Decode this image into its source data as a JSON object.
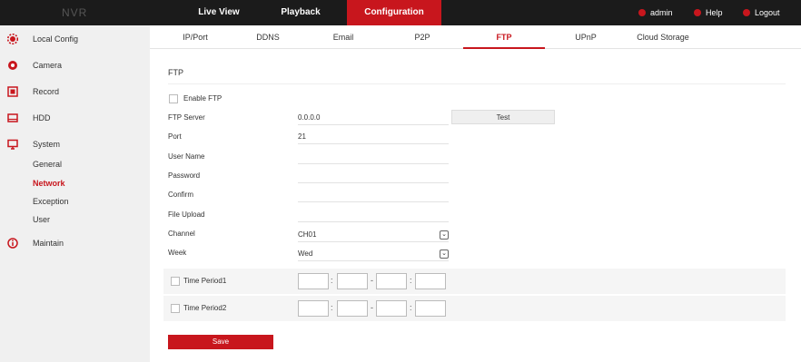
{
  "header": {
    "logo": "NVR",
    "nav": [
      {
        "label": "Live View"
      },
      {
        "label": "Playback"
      },
      {
        "label": "Configuration"
      }
    ],
    "user": "admin",
    "help": "Help",
    "logout": "Logout"
  },
  "sidebar": {
    "items": [
      {
        "label": "Local Config"
      },
      {
        "label": "Camera"
      },
      {
        "label": "Record"
      },
      {
        "label": "HDD"
      },
      {
        "label": "System"
      },
      {
        "label": "Maintain"
      }
    ],
    "sub": [
      {
        "label": "General"
      },
      {
        "label": "Network"
      },
      {
        "label": "Exception"
      },
      {
        "label": "User"
      }
    ]
  },
  "tabs": [
    {
      "label": "IP/Port"
    },
    {
      "label": "DDNS"
    },
    {
      "label": "Email"
    },
    {
      "label": "P2P"
    },
    {
      "label": "FTP"
    },
    {
      "label": "UPnP"
    },
    {
      "label": "Cloud Storage"
    }
  ],
  "form": {
    "section_title": "FTP",
    "enable_label": "Enable FTP",
    "server_label": "FTP Server",
    "server_value": "0.0.0.0",
    "test_label": "Test",
    "port_label": "Port",
    "port_value": "21",
    "username_label": "User Name",
    "password_label": "Password",
    "confirm_label": "Confirm",
    "upload_label": "File Upload",
    "channel_label": "Channel",
    "channel_value": "CH01",
    "week_label": "Week",
    "week_value": "Wed",
    "period1_label": "Time Period1",
    "period2_label": "Time Period2",
    "save_label": "Save"
  },
  "colors": {
    "accent": "#c8161d",
    "topbar": "#1b1b1b",
    "sidebar": "#f0f0f0"
  }
}
